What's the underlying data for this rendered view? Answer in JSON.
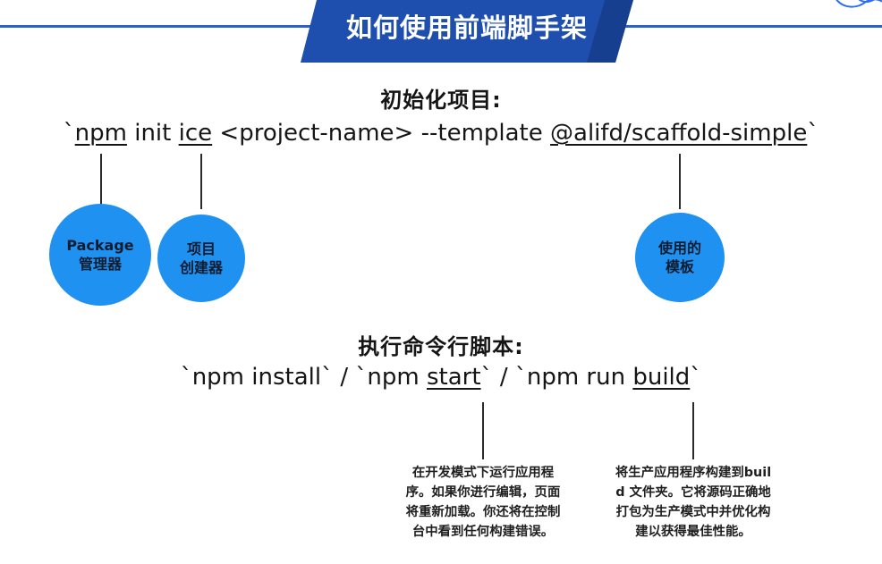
{
  "title": "如何使用前端脚手架",
  "colors": {
    "banner": "#1f4fae",
    "banner_dark": "#173f8f",
    "accent_line": "#2b62c6",
    "bubble": "#1f91f0"
  },
  "section_init": {
    "heading": "初始化项目:",
    "command": {
      "open_tick": "`",
      "npm": "npm",
      "init": "init",
      "ice": "ice",
      "project_name": "<project-name>",
      "template_flag": "--template",
      "template_value": "@alifd/scaffold-simple",
      "close_tick": "`"
    },
    "bubbles": {
      "package_manager": {
        "line1": "Package",
        "line2": "管理器"
      },
      "project_creator": {
        "line1": "项目",
        "line2": "创建器"
      },
      "template_used": {
        "line1": "使用的",
        "line2": "模板"
      }
    }
  },
  "section_scripts": {
    "heading": "执行命令行脚本:",
    "command": {
      "install": "`npm install`",
      "sep1": "/",
      "start_prefix": "`npm",
      "start_word": "start",
      "start_suffix": "`",
      "sep2": "/",
      "build_prefix": "`npm run",
      "build_word": "build",
      "build_suffix": "`"
    },
    "notes": {
      "start": "在开发模式下运行应用程序。如果你进行编辑，页面将重新加载。你还将在控制台中看到任何构建错误。",
      "build": "将生产应用程序构建到build 文件夹。它将源码正确地打包为生产模式中并优化构建以获得最佳性能。"
    }
  }
}
